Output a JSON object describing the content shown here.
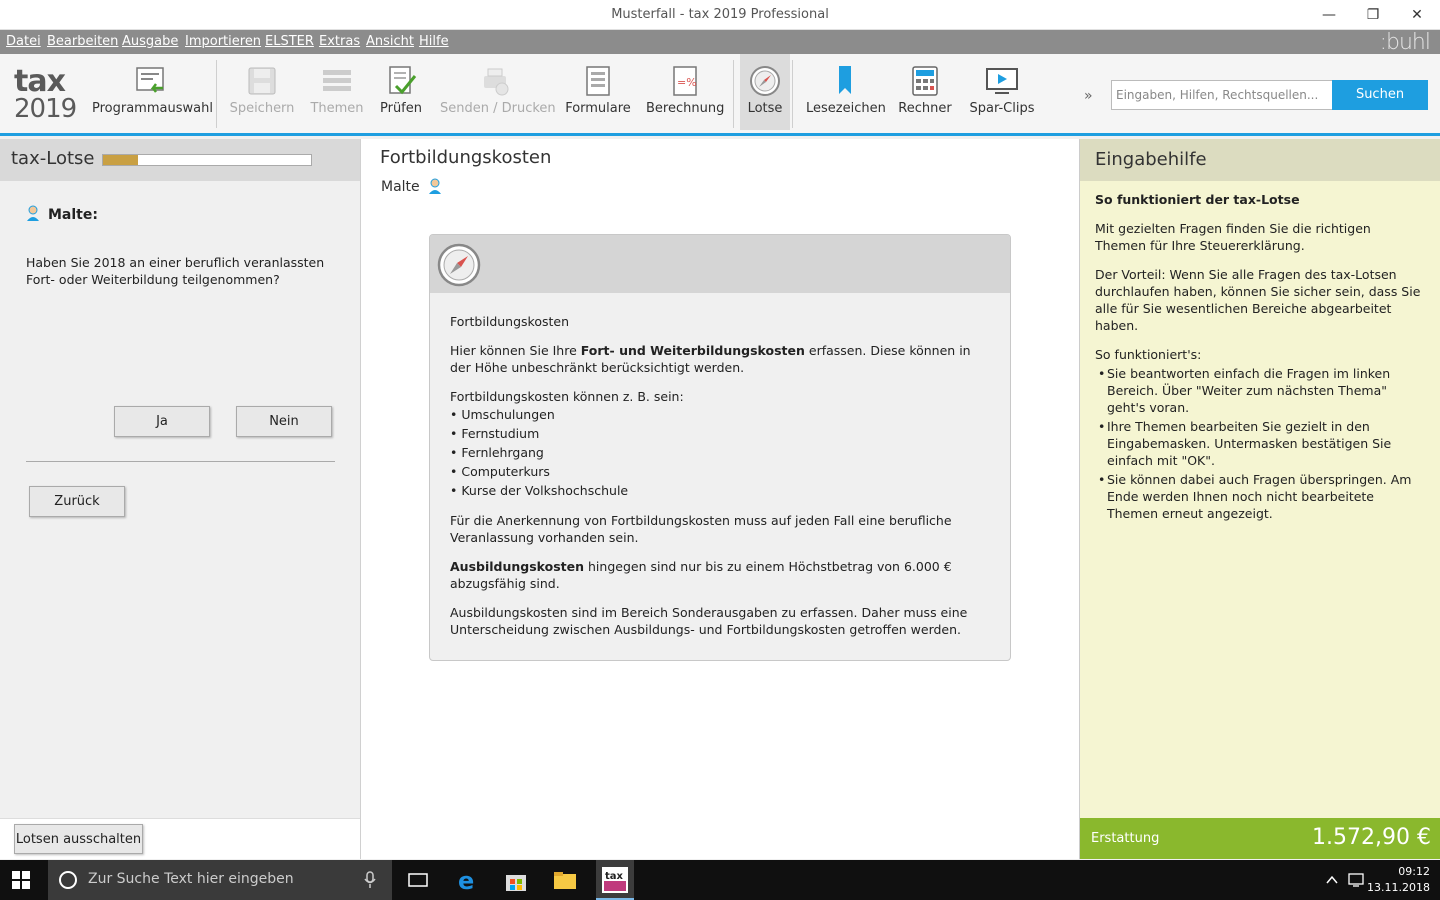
{
  "window": {
    "title": "Musterfall - tax 2019 Professional"
  },
  "menu": [
    "Datei",
    "Bearbeiten",
    "Ausgabe",
    "Importieren",
    "ELSTER",
    "Extras",
    "Ansicht",
    "Hilfe"
  ],
  "brand": ":buhl",
  "logo": {
    "line1": "tax",
    "line2": "2019"
  },
  "toolbar": {
    "programmauswahl": "Programmauswahl",
    "speichern": "Speichern",
    "themen": "Themen",
    "pruefen": "Prüfen",
    "senden": "Senden / Drucken",
    "formulare": "Formulare",
    "berechnung": "Berechnung",
    "lotse": "Lotse",
    "lesezeichen": "Lesezeichen",
    "rechner": "Rechner",
    "sparclips": "Spar-Clips",
    "more": "»"
  },
  "search": {
    "placeholder": "Eingaben, Hilfen, Rechtsquellen...",
    "button": "Suchen"
  },
  "left": {
    "title": "tax-Lotse",
    "progress": 0.17,
    "person": "Malte:",
    "question": "Haben Sie 2018 an einer beruflich veranlassten Fort- oder Weiterbildung teilgenommen?",
    "yes": "Ja",
    "no": "Nein",
    "back": "Zurück",
    "toggle": "Lotsen ausschalten"
  },
  "center": {
    "title": "Fortbildungskosten",
    "person": "Malte",
    "card": {
      "heading": "Fortbildungskosten",
      "p1_pre": "Hier können Sie Ihre ",
      "p1_bold": "Fort- und Weiterbildungskosten",
      "p1_post": " erfassen. Diese können in der Höhe unbeschränkt berücksichtigt werden.",
      "p2": "Fortbildungskosten können z. B. sein:",
      "list": [
        "Umschulungen",
        "Fernstudium",
        "Fernlehrgang",
        "Computerkurs",
        "Kurse der Volkshochschule"
      ],
      "p3": "Für die Anerkennung von Fortbildungskosten muss auf jeden Fall eine berufliche Veranlassung vorhanden sein.",
      "p4_bold": "Ausbildungskosten",
      "p4_post": " hingegen sind nur bis zu einem Höchstbetrag von 6.000 € abzugsfähig sind.",
      "p5": "Ausbildungskosten sind im Bereich Sonderausgaben zu erfassen. Daher muss eine Unterscheidung zwischen Ausbildungs- und Fortbildungskosten getroffen werden."
    }
  },
  "right": {
    "title": "Eingabehilfe",
    "heading": "So funktioniert der tax-Lotse",
    "p1": "Mit gezielten Fragen finden Sie die richtigen Themen für Ihre Steuererklärung.",
    "p2": "Der Vorteil: Wenn Sie alle Fragen des tax-Lotsen durchlaufen haben, können Sie sicher sein, dass Sie alle für Sie wesentlichen Bereiche abgearbeitet haben.",
    "p3": "So funktioniert's:",
    "list": [
      "Sie beantworten einfach die Fragen im linken Bereich. Über \"Weiter zum nächsten Thema\" geht's voran.",
      "Ihre Themen bearbeiten Sie gezielt in den Eingabemasken. Untermasken bestätigen Sie einfach mit \"OK\".",
      "Sie können dabei auch Fragen überspringen. Am Ende werden Ihnen noch nicht bearbeitete Themen erneut angezeigt."
    ],
    "refund_label": "Erstattung",
    "refund_value": "1.572,90 €"
  },
  "taskbar": {
    "search_placeholder": "Zur Suche Text hier eingeben",
    "time": "09:12",
    "date": "13.11.2018"
  }
}
